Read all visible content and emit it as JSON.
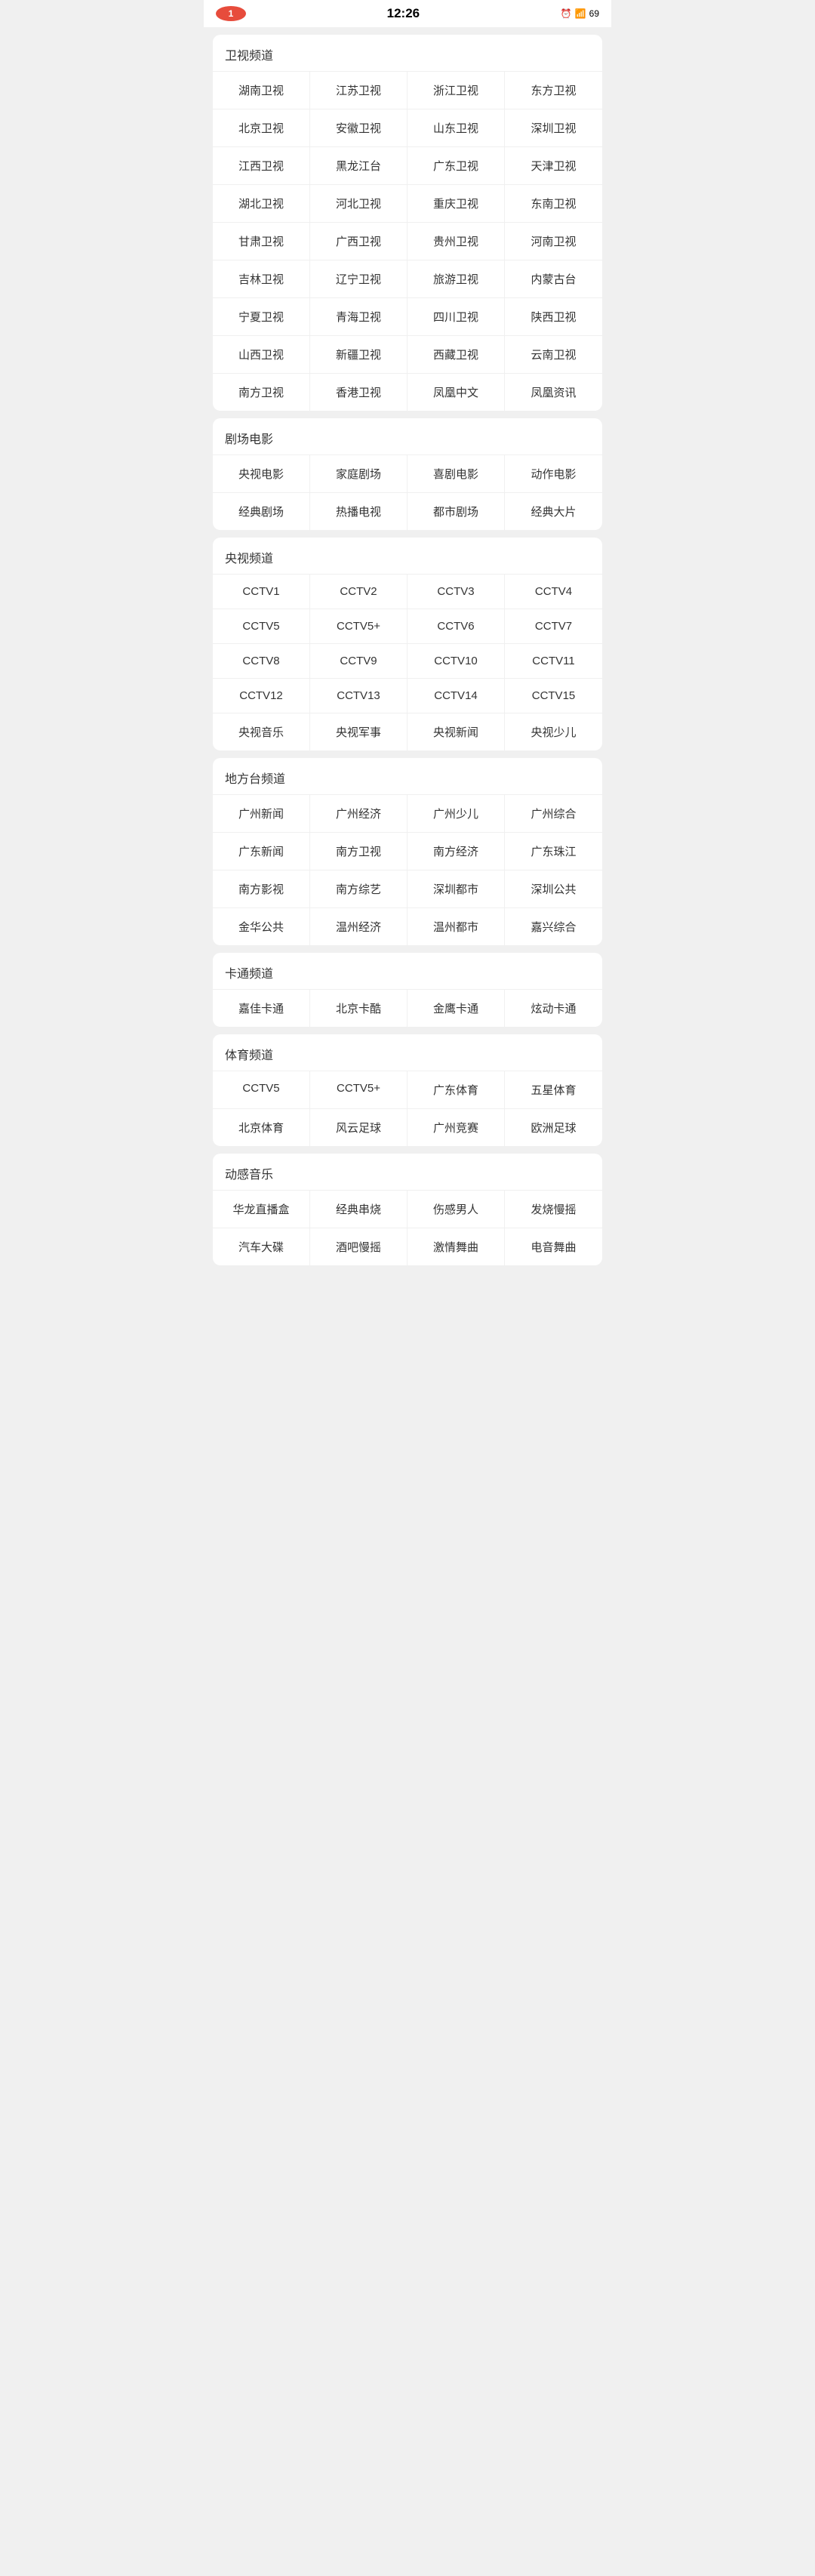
{
  "statusBar": {
    "notification": "1",
    "time": "12:26",
    "battery": "69",
    "batteryIcon": "🔋"
  },
  "sections": [
    {
      "id": "satellite",
      "title": "卫视频道",
      "items": [
        "湖南卫视",
        "江苏卫视",
        "浙江卫视",
        "东方卫视",
        "北京卫视",
        "安徽卫视",
        "山东卫视",
        "深圳卫视",
        "江西卫视",
        "黑龙江台",
        "广东卫视",
        "天津卫视",
        "湖北卫视",
        "河北卫视",
        "重庆卫视",
        "东南卫视",
        "甘肃卫视",
        "广西卫视",
        "贵州卫视",
        "河南卫视",
        "吉林卫视",
        "辽宁卫视",
        "旅游卫视",
        "内蒙古台",
        "宁夏卫视",
        "青海卫视",
        "四川卫视",
        "陕西卫视",
        "山西卫视",
        "新疆卫视",
        "西藏卫视",
        "云南卫视",
        "南方卫视",
        "香港卫视",
        "凤凰中文",
        "凤凰资讯"
      ]
    },
    {
      "id": "movies",
      "title": "剧场电影",
      "items": [
        "央视电影",
        "家庭剧场",
        "喜剧电影",
        "动作电影",
        "经典剧场",
        "热播电视",
        "都市剧场",
        "经典大片"
      ]
    },
    {
      "id": "cctv",
      "title": "央视频道",
      "items": [
        "CCTV1",
        "CCTV2",
        "CCTV3",
        "CCTV4",
        "CCTV5",
        "CCTV5+",
        "CCTV6",
        "CCTV7",
        "CCTV8",
        "CCTV9",
        "CCTV10",
        "CCTV11",
        "CCTV12",
        "CCTV13",
        "CCTV14",
        "CCTV15",
        "央视音乐",
        "央视军事",
        "央视新闻",
        "央视少儿"
      ]
    },
    {
      "id": "local",
      "title": "地方台频道",
      "items": [
        "广州新闻",
        "广州经济",
        "广州少儿",
        "广州综合",
        "广东新闻",
        "南方卫视",
        "南方经济",
        "广东珠江",
        "南方影视",
        "南方综艺",
        "深圳都市",
        "深圳公共",
        "金华公共",
        "温州经济",
        "温州都市",
        "嘉兴综合"
      ]
    },
    {
      "id": "cartoon",
      "title": "卡通频道",
      "items": [
        "嘉佳卡通",
        "北京卡酷",
        "金鹰卡通",
        "炫动卡通"
      ]
    },
    {
      "id": "sports",
      "title": "体育频道",
      "items": [
        "CCTV5",
        "CCTV5+",
        "广东体育",
        "五星体育",
        "北京体育",
        "风云足球",
        "广州竞赛",
        "欧洲足球"
      ]
    },
    {
      "id": "music",
      "title": "动感音乐",
      "items": [
        "华龙直播盒",
        "经典串烧",
        "伤感男人",
        "发烧慢摇",
        "汽车大碟",
        "酒吧慢摇",
        "激情舞曲",
        "电音舞曲"
      ]
    }
  ]
}
